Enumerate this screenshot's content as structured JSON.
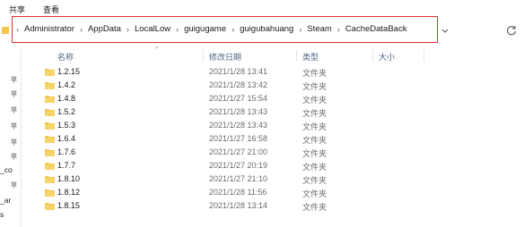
{
  "menu": {
    "share": "共享",
    "view": "查看"
  },
  "breadcrumb": [
    "Administrator",
    "AppData",
    "LocalLow",
    "guigugame",
    "guigubahuang",
    "Steam",
    "CacheDataBack"
  ],
  "columns": {
    "name": "名称",
    "modified": "修改日期",
    "type": "类型",
    "size": "大小"
  },
  "rows": [
    {
      "name": "1.2.15",
      "date": "2021/1/28 13:41",
      "type": "文件夹"
    },
    {
      "name": "1.4.2",
      "date": "2021/1/28 13:42",
      "type": "文件夹"
    },
    {
      "name": "1.4.8",
      "date": "2021/1/27 15:54",
      "type": "文件夹"
    },
    {
      "name": "1.5.2",
      "date": "2021/1/28 13:43",
      "type": "文件夹"
    },
    {
      "name": "1.5.3",
      "date": "2021/1/28 13:43",
      "type": "文件夹"
    },
    {
      "name": "1.6.4",
      "date": "2021/1/27 16:58",
      "type": "文件夹"
    },
    {
      "name": "1.7.6",
      "date": "2021/1/27 21:00",
      "type": "文件夹"
    },
    {
      "name": "1.7.7",
      "date": "2021/1/27 20:19",
      "type": "文件夹"
    },
    {
      "name": "1.8.10",
      "date": "2021/1/27 21:10",
      "type": "文件夹"
    },
    {
      "name": "1.8.12",
      "date": "2021/1/28 11:56",
      "type": "文件夹"
    },
    {
      "name": "1.8.15",
      "date": "2021/1/28 13:14",
      "type": "文件夹"
    }
  ],
  "sidebar_clipped": [
    "_co",
    "_ar",
    "s"
  ],
  "colors": {
    "highlight_border": "#e0312f",
    "folder": "#f2c84b",
    "header_text": "#4b6584"
  }
}
